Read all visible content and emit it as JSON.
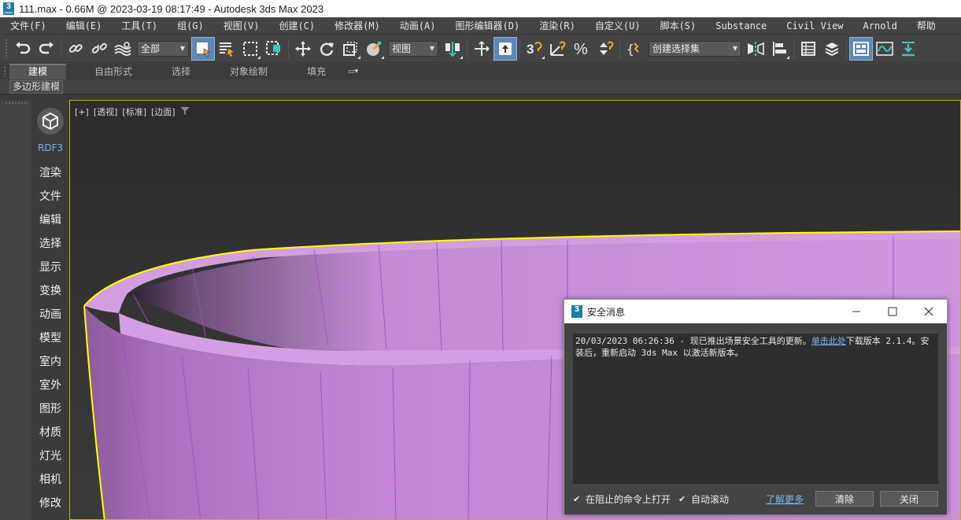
{
  "window": {
    "icon_text": "3",
    "title": "111.max - 0.66M @ 2023-03-19 08:17:49 - Autodesk 3ds Max 2023"
  },
  "menu": {
    "items": [
      {
        "label": "文件(F)"
      },
      {
        "label": "编辑(E)"
      },
      {
        "label": "工具(T)"
      },
      {
        "label": "组(G)"
      },
      {
        "label": "视图(V)"
      },
      {
        "label": "创建(C)"
      },
      {
        "label": "修改器(M)"
      },
      {
        "label": "动画(A)"
      },
      {
        "label": "图形编辑器(D)"
      },
      {
        "label": "渲染(R)"
      },
      {
        "label": "自定义(U)"
      },
      {
        "label": "脚本(S)"
      },
      {
        "label": "Substance"
      },
      {
        "label": "Civil View"
      },
      {
        "label": "Arnold"
      },
      {
        "label": "帮助"
      }
    ]
  },
  "toolbar": {
    "selection_filter": "全部",
    "coord_system": "视图",
    "named_selection_set": "创建选择集"
  },
  "ribbon": {
    "tabs": [
      {
        "label": "建模"
      },
      {
        "label": "自由形式"
      },
      {
        "label": "选择"
      },
      {
        "label": "对象绘制"
      },
      {
        "label": "填充"
      }
    ],
    "panel_label": "多边形建模"
  },
  "sidepanel": {
    "title": "RDF3",
    "items": [
      {
        "label": "渲染"
      },
      {
        "label": "文件"
      },
      {
        "label": "编辑"
      },
      {
        "label": "选择"
      },
      {
        "label": "显示"
      },
      {
        "label": "变换"
      },
      {
        "label": "动画"
      },
      {
        "label": "模型"
      },
      {
        "label": "室内"
      },
      {
        "label": "室外"
      },
      {
        "label": "图形"
      },
      {
        "label": "材质"
      },
      {
        "label": "灯光"
      },
      {
        "label": "相机"
      },
      {
        "label": "修改"
      }
    ]
  },
  "viewport": {
    "label_plus": "[+]",
    "label_view": "[透视]",
    "label_shading": "[标准]",
    "label_mode": "[边面]",
    "object_color": "#c98ad9",
    "selection_color": "#ffff00"
  },
  "dialog": {
    "icon_text": "3",
    "title": "安全消息",
    "message_prefix": "20/03/2023 06:26:36 - 现已推出场景安全工具的更新。",
    "message_link": "单击此处",
    "message_suffix": "下载版本 2.1.4。安装后，重新启动 3ds Max 以激活新版本。",
    "checkbox_open_on_block": {
      "label": "在阻止的命令上打开",
      "checked": true
    },
    "checkbox_autoscroll": {
      "label": "自动滚动",
      "checked": true
    },
    "learn_more": "了解更多",
    "clear_button": "清除",
    "close_button": "关闭"
  }
}
